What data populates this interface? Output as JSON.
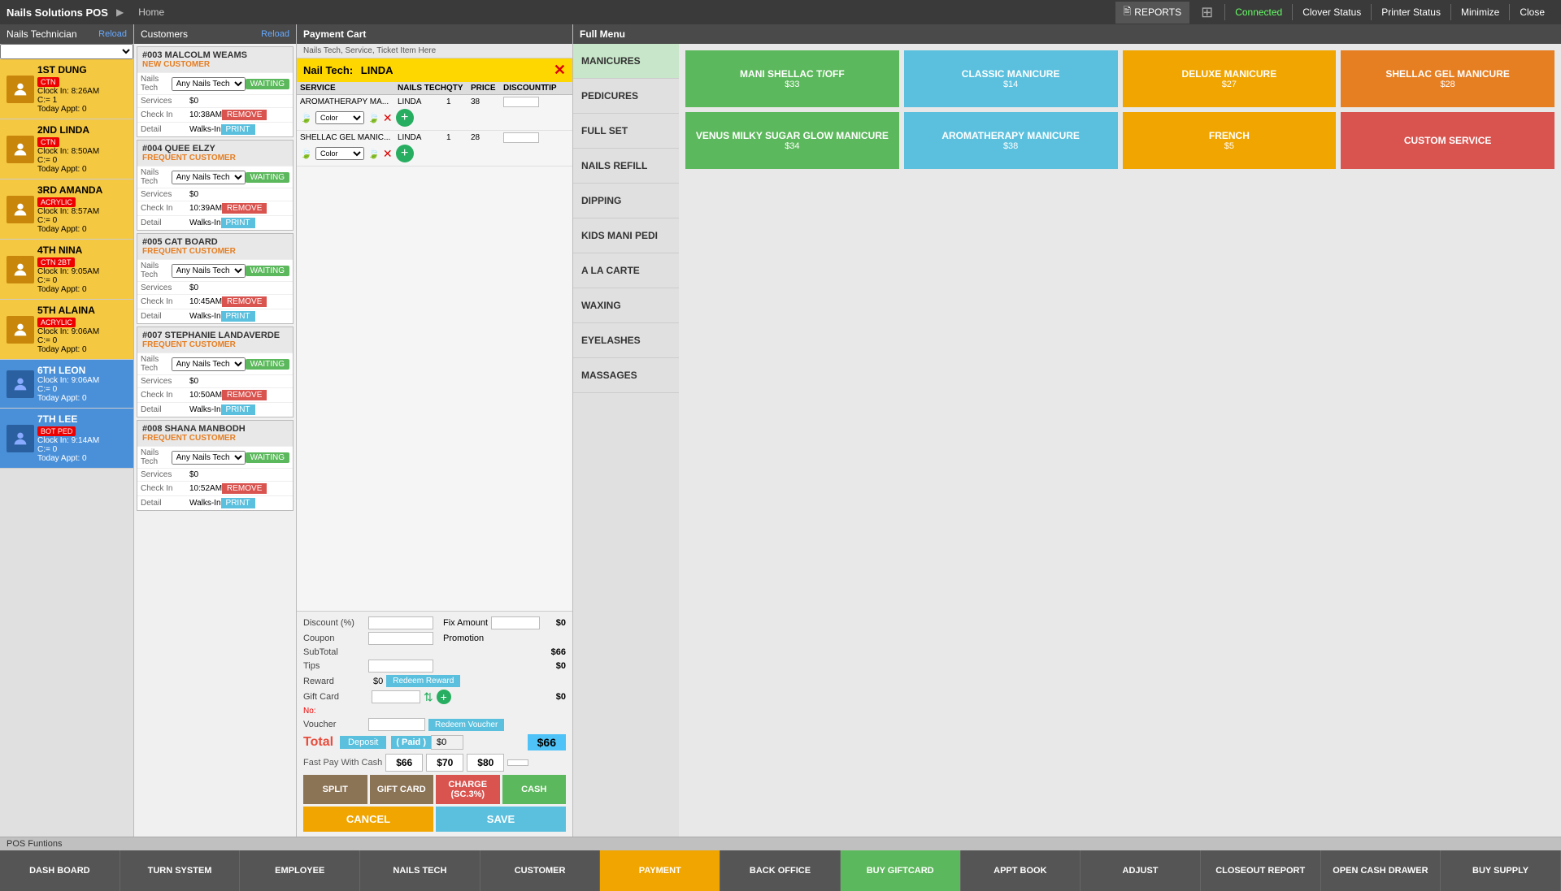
{
  "topbar": {
    "brand": "Nails Solutions POS",
    "arrow": "▶",
    "home": "Home",
    "reports": "REPORTS",
    "grid_icon": "⊞",
    "connected": "Connected",
    "clover_status": "Clover Status",
    "printer_status": "Printer Status",
    "minimize": "Minimize",
    "close": "Close"
  },
  "left_panel": {
    "title": "Nails Technician",
    "reload": "Reload",
    "techs": [
      {
        "num": "1ST",
        "name": "DUNG",
        "badge": "CTN",
        "clock": "Clock In: 8:26AM",
        "c": "C:= 1",
        "appt": "Today Appt: 0",
        "color": "yellow"
      },
      {
        "num": "2ND",
        "name": "LINDA",
        "badge": "CTN",
        "clock": "Clock In: 8:50AM",
        "c": "C:= 0",
        "appt": "Today Appt: 0",
        "color": "yellow"
      },
      {
        "num": "3RD",
        "name": "AMANDA",
        "badge": "ACRYLIC",
        "clock": "Clock In: 8:57AM",
        "c": "C:= 0",
        "appt": "Today Appt: 0",
        "color": "yellow"
      },
      {
        "num": "4TH",
        "name": "NINA",
        "badge": "CTN  2BT",
        "clock": "Clock In: 9:05AM",
        "c": "C:= 0",
        "appt": "Today Appt: 0",
        "color": "yellow"
      },
      {
        "num": "5TH",
        "name": "ALAINA",
        "badge": "ACRYLIC",
        "clock": "Clock In: 9:06AM",
        "c": "C:= 0",
        "appt": "Today Appt: 0",
        "color": "yellow"
      },
      {
        "num": "6TH",
        "name": "LEON",
        "badge": "",
        "clock": "Clock In: 9:06AM",
        "c": "C:= 0",
        "appt": "Today Appt: 0",
        "color": "blue"
      },
      {
        "num": "7TH",
        "name": "LEE",
        "badge": "BOT  PED",
        "clock": "Clock In: 9:14AM",
        "c": "C:= 0",
        "appt": "Today Appt: 0",
        "color": "blue"
      }
    ]
  },
  "mid_panel": {
    "title": "Customers",
    "reload": "Reload",
    "customers": [
      {
        "id": "#003",
        "name": "MALCOLM WEAMS",
        "type": "NEW CUSTOMER",
        "nails_tech_label": "Nails Tech",
        "nails_tech_val": "Any Nails Tech",
        "services_label": "Services",
        "services_val": "$0",
        "checkin_label": "Check In",
        "checkin_val": "10:38AM",
        "detail_label": "Detail",
        "detail_val": "Walks-In",
        "status": "WAITING",
        "remove": "REMOVE",
        "print": "PRINT"
      },
      {
        "id": "#004",
        "name": "QUEE ELZY",
        "type": "FREQUENT CUSTOMER",
        "nails_tech_label": "Nails Tech",
        "nails_tech_val": "Any Nails Tech",
        "services_label": "Services",
        "services_val": "$0",
        "checkin_label": "Check In",
        "checkin_val": "10:39AM",
        "detail_label": "Detail",
        "detail_val": "Walks-In",
        "status": "WAITING",
        "remove": "REMOVE",
        "print": "PRINT"
      },
      {
        "id": "#005",
        "name": "CAT BOARD",
        "type": "FREQUENT CUSTOMER",
        "nails_tech_label": "Nails Tech",
        "nails_tech_val": "Any Nails Tech",
        "services_label": "Services",
        "services_val": "$0",
        "checkin_label": "Check In",
        "checkin_val": "10:45AM",
        "detail_label": "Detail",
        "detail_val": "Walks-In",
        "status": "WAITING",
        "remove": "REMOVE",
        "print": "PRINT"
      },
      {
        "id": "#007",
        "name": "STEPHANIE LANDAVERDE",
        "type": "FREQUENT CUSTOMER",
        "nails_tech_label": "Nails Tech",
        "nails_tech_val": "Any Nails Tech",
        "services_label": "Services",
        "services_val": "$0",
        "checkin_label": "Check In",
        "checkin_val": "10:50AM",
        "detail_label": "Detail",
        "detail_val": "Walks-In",
        "status": "WAITING",
        "remove": "REMOVE",
        "print": "PRINT"
      },
      {
        "id": "#008",
        "name": "SHANA MANBODH",
        "type": "FREQUENT CUSTOMER",
        "nails_tech_label": "Nails Tech",
        "nails_tech_val": "Any Nails Tech",
        "services_label": "Services",
        "services_val": "$0",
        "checkin_label": "Check In",
        "checkin_val": "10:52AM",
        "detail_label": "Detail",
        "detail_val": "Walks-In",
        "status": "WAITING",
        "remove": "REMOVE",
        "print": "PRINT"
      }
    ]
  },
  "cart": {
    "title": "Payment Cart",
    "subtitle": "Nails Tech, Service, Ticket Item Here",
    "nail_tech_label": "Nail Tech:",
    "nail_tech_name": "LINDA",
    "close_icon": "✕",
    "table_headers": [
      "SERVICE",
      "NAILS TECH",
      "QTY",
      "PRICE",
      "DISCOUNT",
      "TIP"
    ],
    "items": [
      {
        "service": "AROMATHERAPY MA...",
        "tech": "LINDA",
        "qty": "1",
        "price": "38",
        "discount": "",
        "tip": "",
        "color_option": "Color"
      },
      {
        "service": "SHELLAC GEL MANIC...",
        "tech": "LINDA",
        "qty": "1",
        "price": "28",
        "discount": "",
        "tip": "",
        "color_option": "Color"
      }
    ],
    "discount_label": "Discount (%)",
    "fix_amount_label": "Fix Amount",
    "coupon_label": "Coupon",
    "promotion_label": "Promotion",
    "subtotal_label": "SubTotal",
    "subtotal_val": "$66",
    "tips_label": "Tips",
    "tips_val": "$0",
    "reward_label": "Reward",
    "reward_val": "$0",
    "redeem_reward": "Redeem Reward",
    "gift_card_label": "Gift Card",
    "gift_card_val": "$0",
    "no_label": "No:",
    "voucher_label": "Voucher",
    "redeem_voucher": "Redeem Voucher",
    "total_label": "Total",
    "deposit_btn": "Deposit",
    "paid_label": "( Paid )",
    "paid_val": "$0",
    "total_amount": "$66",
    "fast_pay_label": "Fast Pay With Cash",
    "fast_pay_amounts": [
      "$66",
      "$70",
      "$80"
    ],
    "split_btn": "SPLIT",
    "gift_btn": "GIFT CARD",
    "charge_btn": "CHARGE (SC.3%)",
    "cash_btn": "CASH",
    "cancel_btn": "CANCEL",
    "save_btn": "SAVE"
  },
  "menu": {
    "title": "Full Menu",
    "categories": [
      {
        "label": "MANICURES",
        "active": true
      },
      {
        "label": "PEDICURES"
      },
      {
        "label": "FULL SET"
      },
      {
        "label": "NAILS REFILL"
      },
      {
        "label": "DIPPING"
      },
      {
        "label": "KIDS MANI PEDI"
      },
      {
        "label": "A LA CARTE"
      },
      {
        "label": "WAXING"
      },
      {
        "label": "EYELASHES"
      },
      {
        "label": "MASSAGES"
      }
    ],
    "items": [
      {
        "label": "MANI SHELLAC T/OFF",
        "price": "$33",
        "color": "green"
      },
      {
        "label": "CLASSIC MANICURE",
        "price": "$14",
        "color": "blue"
      },
      {
        "label": "DELUXE MANICURE",
        "price": "$27",
        "color": "yellow"
      },
      {
        "label": "SHELLAC GEL MANICURE",
        "price": "$28",
        "color": "orange"
      },
      {
        "label": "VENUS MILKY SUGAR GLOW MANICURE",
        "price": "$34",
        "color": "green"
      },
      {
        "label": "AROMATHERAPY MANICURE",
        "price": "$38",
        "color": "blue"
      },
      {
        "label": "FRENCH",
        "price": "$5",
        "color": "yellow"
      },
      {
        "label": "CUSTOM SERVICE",
        "price": "",
        "color": "red"
      }
    ]
  },
  "pos_functions": {
    "label": "POS Funtions",
    "buttons": [
      {
        "label": "DASH BOARD",
        "active": false
      },
      {
        "label": "TURN SYSTEM",
        "active": false
      },
      {
        "label": "EMPLOYEE",
        "active": false
      },
      {
        "label": "NAILS TECH",
        "active": false
      },
      {
        "label": "CUSTOMER",
        "active": false
      },
      {
        "label": "PAYMENT",
        "active": true
      },
      {
        "label": "BACK OFFICE",
        "active": false
      },
      {
        "label": "BUY GIFTCARD",
        "active": false,
        "green": true
      },
      {
        "label": "APPT BOOK",
        "active": false
      },
      {
        "label": "ADJUST",
        "active": false
      },
      {
        "label": "CLOSEOUT REPORT",
        "active": false
      },
      {
        "label": "OPEN CASH DRAWER",
        "active": false
      },
      {
        "label": "BUY SUPPLY",
        "active": false
      }
    ]
  }
}
